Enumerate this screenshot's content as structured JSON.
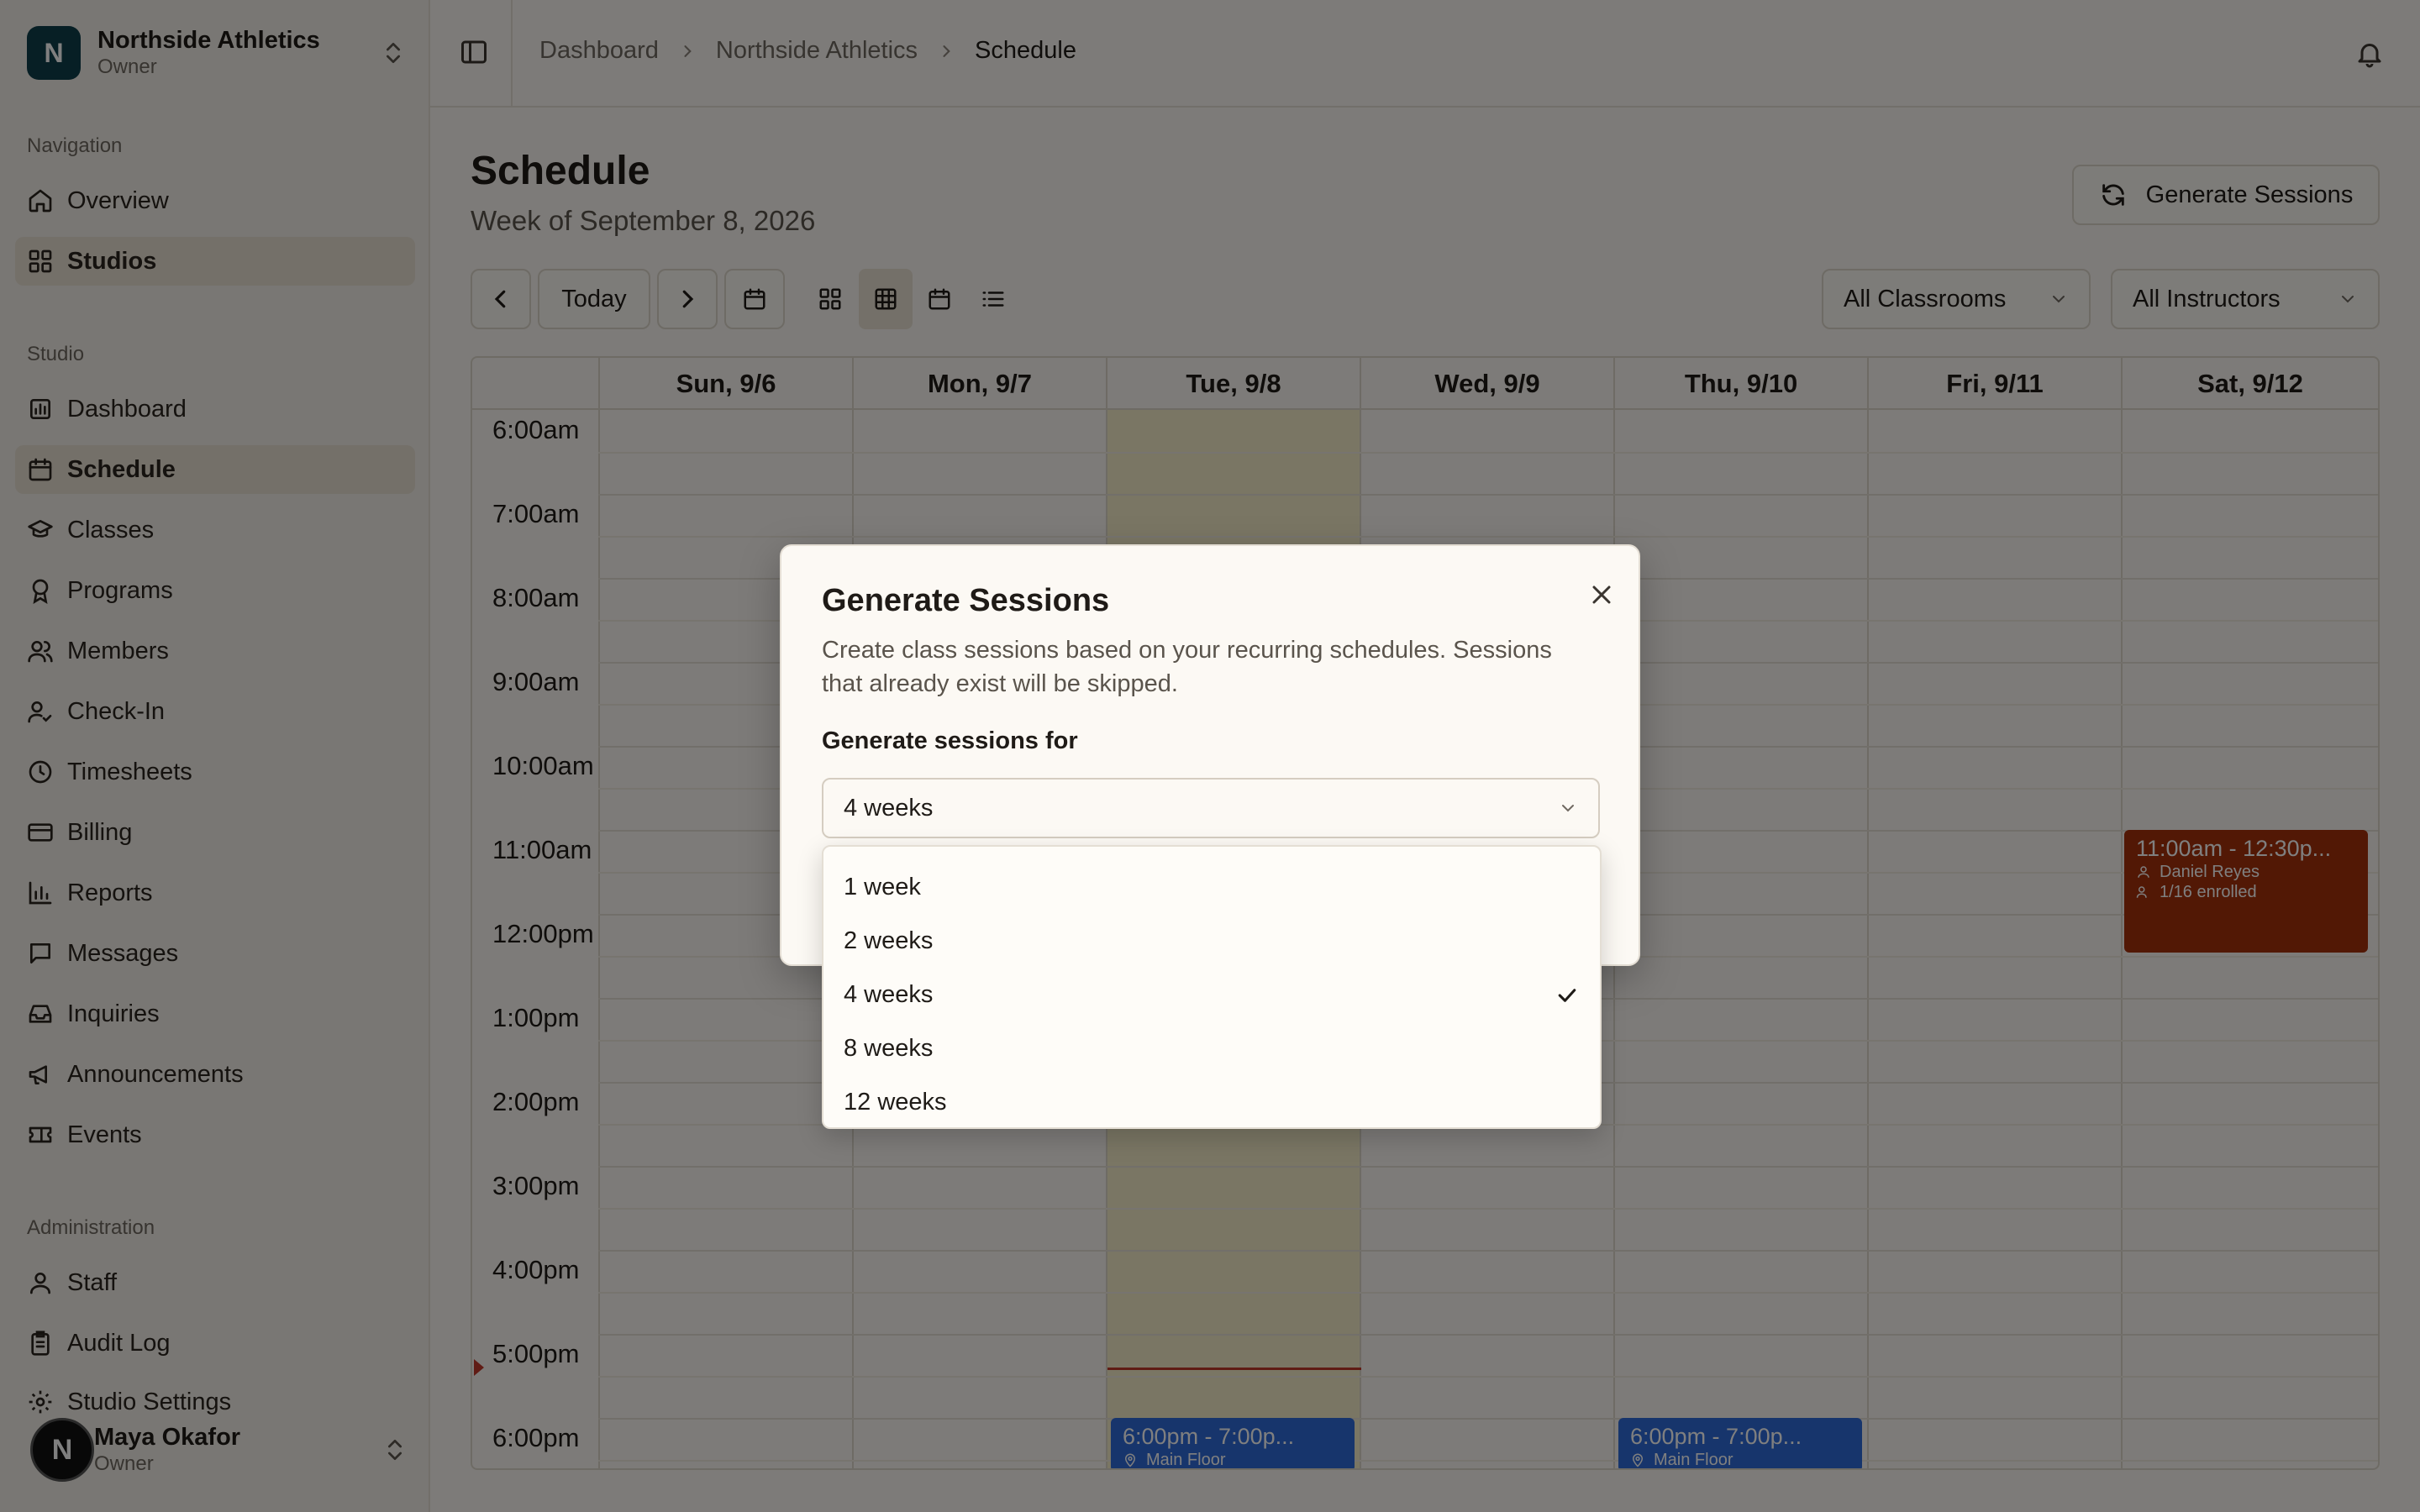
{
  "org": {
    "initial": "N",
    "name": "Northside Athletics",
    "role": "Owner"
  },
  "sidebar": {
    "sections": {
      "navigation": "Navigation",
      "studio": "Studio",
      "administration": "Administration"
    },
    "navigation_items": [
      {
        "label": "Overview",
        "icon": "home-icon"
      },
      {
        "label": "Studios",
        "icon": "grid-icon"
      }
    ],
    "studio_items": [
      {
        "label": "Dashboard",
        "icon": "bar-chart-icon"
      },
      {
        "label": "Schedule",
        "icon": "calendar-icon"
      },
      {
        "label": "Classes",
        "icon": "graduation-cap-icon"
      },
      {
        "label": "Programs",
        "icon": "award-icon"
      },
      {
        "label": "Members",
        "icon": "users-icon"
      },
      {
        "label": "Check-In",
        "icon": "user-check-icon"
      },
      {
        "label": "Timesheets",
        "icon": "clock-icon"
      },
      {
        "label": "Billing",
        "icon": "credit-card-icon"
      },
      {
        "label": "Reports",
        "icon": "chart-icon"
      },
      {
        "label": "Messages",
        "icon": "message-icon"
      },
      {
        "label": "Inquiries",
        "icon": "inbox-icon"
      },
      {
        "label": "Announcements",
        "icon": "megaphone-icon"
      },
      {
        "label": "Events",
        "icon": "ticket-icon"
      }
    ],
    "admin_items": [
      {
        "label": "Staff",
        "icon": "user-icon"
      },
      {
        "label": "Audit Log",
        "icon": "clipboard-icon"
      },
      {
        "label": "Studio Settings",
        "icon": "gear-icon"
      }
    ]
  },
  "user": {
    "initial": "N",
    "name": "Maya Okafor",
    "role": "Owner"
  },
  "breadcrumb": [
    "Dashboard",
    "Northside Athletics",
    "Schedule"
  ],
  "page": {
    "title": "Schedule",
    "subtitle": "Week of September 8, 2026",
    "generate_button": "Generate Sessions",
    "today_button": "Today",
    "classroom_filter": "All Classrooms",
    "instructor_filter": "All Instructors"
  },
  "calendar": {
    "days": [
      "Sun, 9/6",
      "Mon, 9/7",
      "Tue, 9/8",
      "Wed, 9/9",
      "Thu, 9/10",
      "Fri, 9/11",
      "Sat, 9/12"
    ],
    "times": [
      "6:00am",
      "7:00am",
      "8:00am",
      "9:00am",
      "10:00am",
      "11:00am",
      "12:00pm",
      "1:00pm",
      "2:00pm",
      "3:00pm",
      "4:00pm",
      "5:00pm",
      "6:00pm"
    ],
    "events": [
      {
        "time": "11:00am - 12:30p...",
        "instructor": "Daniel Reyes",
        "enrolled": "1/16 enrolled",
        "color": "#a5310b"
      },
      {
        "time": "6:00pm - 7:00p...",
        "location": "Main Floor",
        "color": "#2f6ad9"
      },
      {
        "time": "6:00pm - 7:00p...",
        "location": "Main Floor",
        "color": "#2f6ad9"
      }
    ]
  },
  "modal": {
    "title": "Generate Sessions",
    "description": "Create class sessions based on your recurring schedules. Sessions that already exist will be skipped.",
    "field_label": "Generate sessions for",
    "selected": "4 weeks",
    "options": [
      "1 week",
      "2 weeks",
      "4 weeks",
      "8 weeks",
      "12 weeks"
    ]
  }
}
